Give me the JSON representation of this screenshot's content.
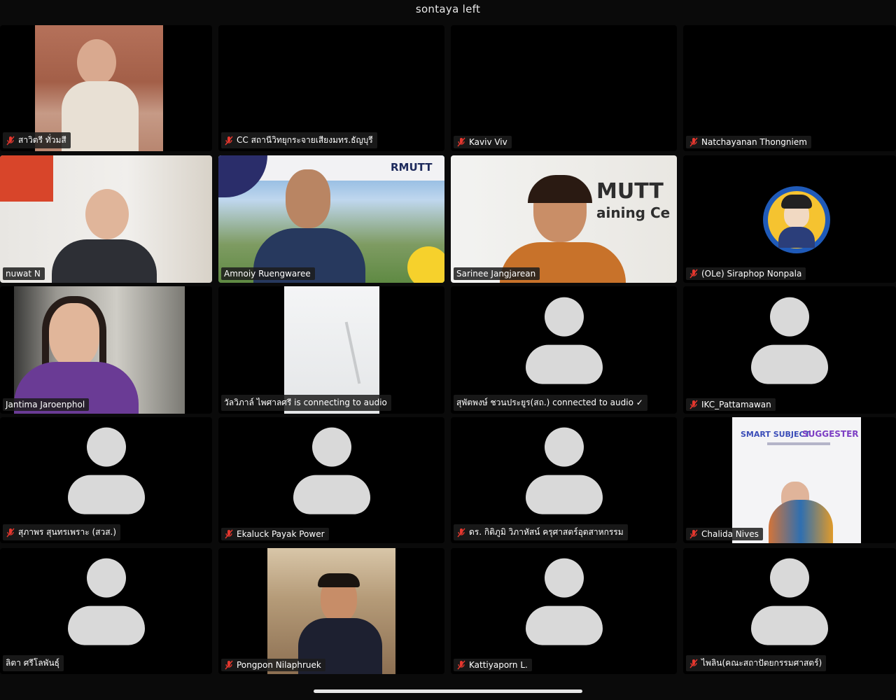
{
  "window": {
    "title": "sontaya left"
  },
  "tiles": [
    {
      "name": "สาวิตรี ทั่วมสี",
      "muted": true
    },
    {
      "name": "CC สถานีวิทยุกระจายเสียงมทร.ธัญบุรี",
      "muted": true
    },
    {
      "name": "Kaviv Viv",
      "muted": true
    },
    {
      "name": "Natchayanan Thongniem",
      "muted": true
    },
    {
      "name": "nuwat N",
      "muted": false
    },
    {
      "name": "Amnoiy Ruengwaree",
      "muted": false,
      "active": true
    },
    {
      "name": "Sarinee Jangjarean",
      "muted": false
    },
    {
      "name": "(OLe) Siraphop Nonpala",
      "muted": true
    },
    {
      "name": "Jantima Jaroenphol",
      "muted": false
    },
    {
      "name": "วัลวิภาล์ ไพศาลศรี is connecting to audio",
      "muted": false
    },
    {
      "name": "สุพัตพงษ์ ชวนประยูร(สถ.) connected to audio ✓",
      "muted": false
    },
    {
      "name": "IKC_Pattamawan",
      "muted": true
    },
    {
      "name": "สุภาพร สุนทรเพราะ (สวส.)",
      "muted": true
    },
    {
      "name": "Ekaluck Payak Power",
      "muted": true
    },
    {
      "name": "ดร. กิติภูมิ วิภาหัสน์ ครุศาสตร์อุตสาหกรรม",
      "muted": true
    },
    {
      "name": "Chalida Nives",
      "muted": true
    },
    {
      "name": "ลิตา ศรีโลพันธุ์",
      "muted": false
    },
    {
      "name": "Pongpon Nilaphruek",
      "muted": true
    },
    {
      "name": "Kattiyaporn L.",
      "muted": true
    },
    {
      "name": "ไพลิน(คณะสถาปัตยกรรมศาสตร์)",
      "muted": true
    }
  ],
  "overlays": {
    "rmutt_logo": "RMUTT",
    "office_sign_1": "MUTT",
    "office_sign_2": "aining Ce",
    "poster_title_a": "SMART SUBJECT",
    "poster_title_b": "SUGGESTER"
  },
  "colors": {
    "active_border": "#35c24a",
    "muted_icon": "#e5372e",
    "avatar": "#d9d9d9"
  }
}
